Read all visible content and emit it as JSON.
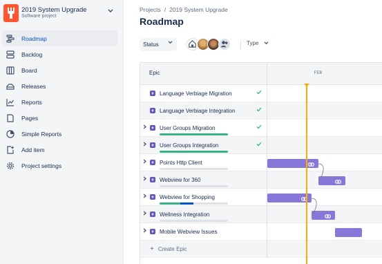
{
  "project": {
    "name": "2019 System Upgrade",
    "type": "Software project"
  },
  "nav": [
    {
      "label": "Roadmap",
      "icon": "roadmap-icon",
      "active": true
    },
    {
      "label": "Backlog",
      "icon": "backlog-icon"
    },
    {
      "label": "Board",
      "icon": "board-icon"
    },
    {
      "label": "Releases",
      "icon": "releases-icon"
    },
    {
      "label": "Reports",
      "icon": "reports-icon"
    },
    {
      "label": "Pages",
      "icon": "pages-icon"
    },
    {
      "label": "Simple Reports",
      "icon": "pie-chart-icon"
    },
    {
      "label": "Add item",
      "icon": "add-item-icon"
    },
    {
      "label": "Project settings",
      "icon": "gear-icon"
    }
  ],
  "breadcrumb": {
    "projects": "Projects",
    "separator": "/",
    "project": "2019 System Upgrade"
  },
  "page_title": "Roadmap",
  "toolbar": {
    "status_label": "Status",
    "type_label": "Type"
  },
  "grid": {
    "epic_header": "Epic",
    "month": "FEB",
    "create_label": "Create Epic"
  },
  "epics": [
    {
      "name": "Language Verbiage Migration",
      "expandable": false,
      "done": true,
      "progress": null
    },
    {
      "name": "Language Verbiage Integration",
      "expandable": false,
      "done": true,
      "progress": null
    },
    {
      "name": "User Groups Migration",
      "expandable": true,
      "done": true,
      "progress": {
        "done": 1.0,
        "in_progress": 0
      }
    },
    {
      "name": "User Groups Integration",
      "expandable": true,
      "done": true,
      "progress": {
        "done": 1.0,
        "in_progress": 0
      }
    },
    {
      "name": "Points Http Client",
      "expandable": true,
      "done": false,
      "progress": {
        "done": 0,
        "in_progress": 0
      }
    },
    {
      "name": "Webview for 360",
      "expandable": true,
      "done": false,
      "progress": {
        "done": 0,
        "in_progress": 0
      }
    },
    {
      "name": "Webview for Shopping",
      "expandable": true,
      "done": false,
      "progress": {
        "done": 0.3,
        "in_progress": 0.2
      }
    },
    {
      "name": "Wellness Integration",
      "expandable": true,
      "done": false,
      "progress": {
        "done": 0,
        "in_progress": 0
      }
    },
    {
      "name": "Mobile Webview Issues",
      "expandable": true,
      "done": false,
      "progress": {
        "done": 0,
        "in_progress": 0
      }
    }
  ],
  "colors": {
    "accent": "#0052cc",
    "epic": "#6554c0",
    "bar": "#8777d9",
    "done": "#36b37e",
    "today": "#ffab00",
    "project_avatar": "#ff5630"
  }
}
